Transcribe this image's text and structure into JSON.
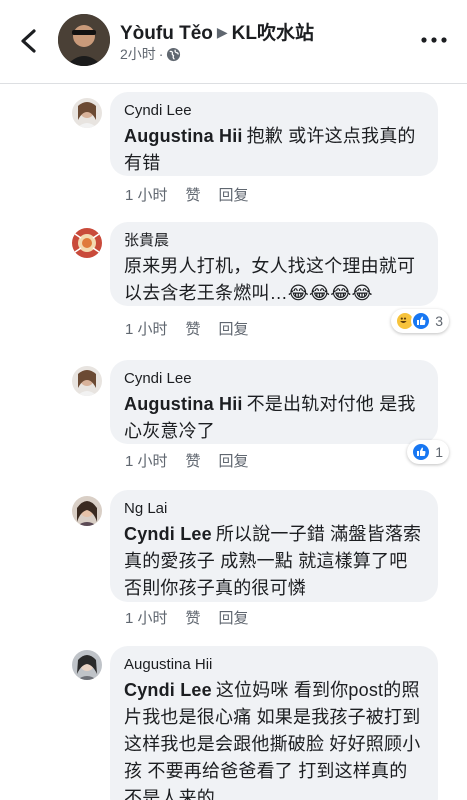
{
  "header": {
    "page_name": "Yòufu Těo",
    "group_name": "KL吹水站",
    "time": "2小时",
    "dot": "·"
  },
  "comments": [
    {
      "author": "Cyndi Lee",
      "mention": "Augustina Hii",
      "text": "抱歉 或许这点我真的有错",
      "time": "1 小时",
      "like": "赞",
      "reply": "回复"
    },
    {
      "author": "张貴晨",
      "mention": "",
      "text": "原来男人打机，女人找这个理由就可以去含老王条燃叫…😂😂😂😂",
      "time": "1 小时",
      "like": "赞",
      "reply": "回复",
      "reaction_count": "3",
      "reaction_icons": [
        "haha-icon",
        "like-icon"
      ]
    },
    {
      "author": "Cyndi Lee",
      "mention": "Augustina Hii",
      "text": "不是出轨对付他 是我心灰意冷了",
      "time": "1 小时",
      "like": "赞",
      "reply": "回复",
      "reaction_count": "1",
      "reaction_icons": [
        "like-icon"
      ]
    },
    {
      "author": "Ng Lai",
      "mention": "Cyndi Lee",
      "text": "所以說一子錯 滿盤皆落索 真的愛孩子 成熟一點 就這樣算了吧 否則你孩子真的很可憐",
      "time": "1 小时",
      "like": "赞",
      "reply": "回复"
    },
    {
      "author": "Augustina Hii",
      "mention": "Cyndi Lee",
      "text": "这位妈咪 看到你post的照片我也是很心痛 如果是我孩子被打到这样我也是会跟他撕破脸 好好照顾小孩 不要再给爸爸看了 打到这样真的不是人来的"
    }
  ],
  "colors": {
    "bubble": "#f0f2f5",
    "text": "#1c1e21",
    "meta": "#606770",
    "like_blue": "#1877f2",
    "haha_yellow": "#f7c33b"
  }
}
